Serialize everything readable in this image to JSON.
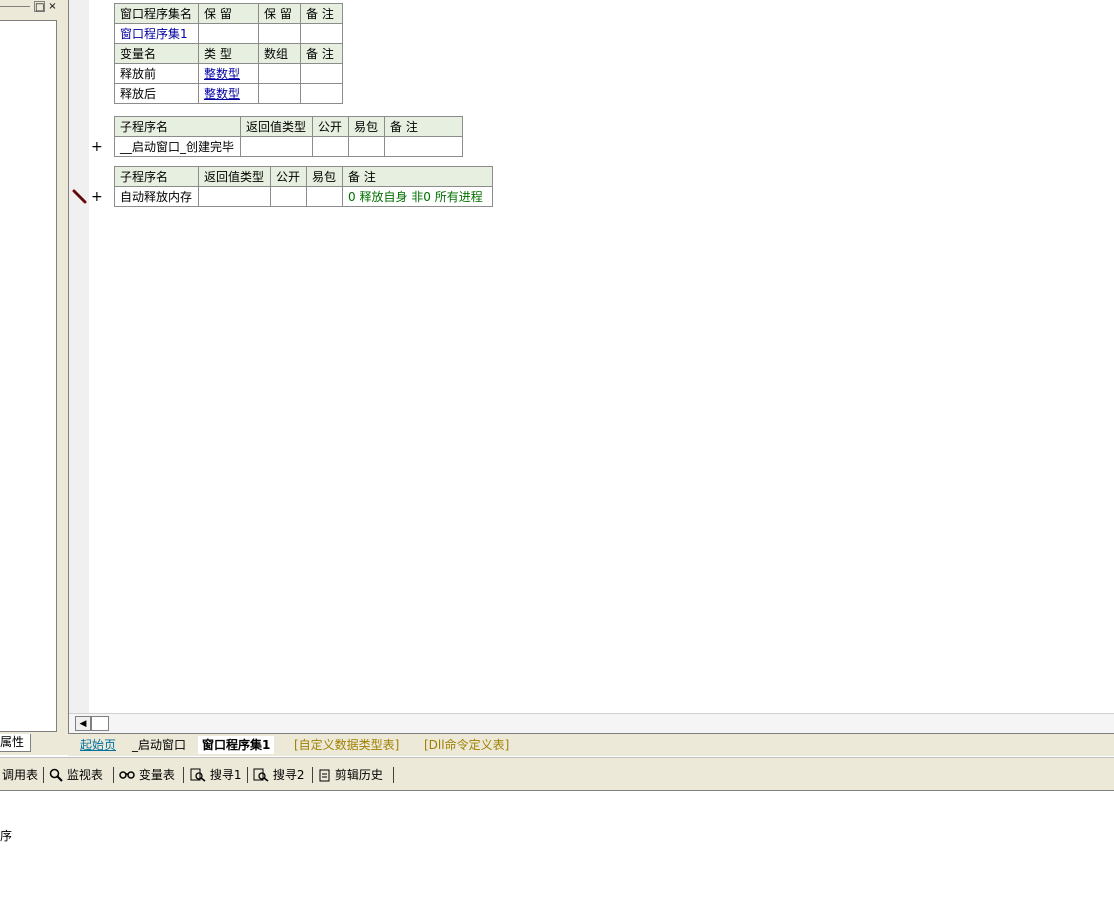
{
  "left_panel": {
    "restore_glyph": "□",
    "close_glyph": "×",
    "properties_tab": "属性"
  },
  "editor": {
    "assembly_table": {
      "headers": [
        "窗口程序集名",
        "保 留",
        "保 留",
        "备 注"
      ],
      "row": [
        "窗口程序集1",
        "",
        "",
        ""
      ]
    },
    "variable_table": {
      "headers": [
        "变量名",
        "类 型",
        "数组",
        "备 注"
      ],
      "rows": [
        [
          "释放前",
          "整数型",
          "",
          ""
        ],
        [
          "释放后",
          "整数型",
          "",
          ""
        ]
      ]
    },
    "sub1": {
      "headers": [
        "子程序名",
        "返回值类型",
        "公开",
        "易包",
        "备 注"
      ],
      "row": [
        "__启动窗口_创建完毕",
        "",
        "",
        "",
        ""
      ]
    },
    "sub2": {
      "headers": [
        "子程序名",
        "返回值类型",
        "公开",
        "易包",
        "备 注"
      ],
      "row": [
        "自动释放内存",
        "",
        "",
        "",
        "0 释放自身 非0 所有进程"
      ]
    },
    "plus_glyph": "+"
  },
  "tabs": [
    {
      "label": "起始页",
      "color": "#0070a0"
    },
    {
      "label": "_启动窗口",
      "color": "#000000"
    },
    {
      "label": "窗口程序集1",
      "color": "#000000",
      "active": true
    },
    {
      "label": "[自定义数据类型表]",
      "color": "#a08000"
    },
    {
      "label": "[Dll命令定义表]",
      "color": "#a08000"
    }
  ],
  "bottom_toolbar": {
    "call_table": "调用表",
    "watch_table": "监视表",
    "variable_table": "变量表",
    "search1": "搜寻1",
    "search2": "搜寻2",
    "clip_history": "剪辑历史"
  },
  "output": {
    "line": "序"
  }
}
